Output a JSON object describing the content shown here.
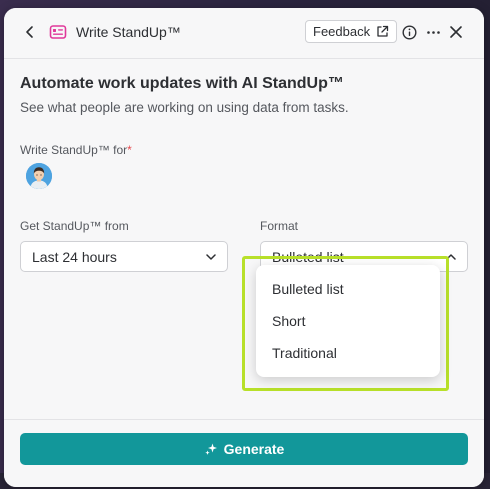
{
  "header": {
    "title": "Write StandUp™",
    "feedback_label": "Feedback",
    "icons": [
      "back-icon",
      "standup-app-icon",
      "external-link-icon",
      "info-icon",
      "more-icon",
      "close-icon"
    ]
  },
  "main": {
    "heading": "Automate work updates with AI StandUp™",
    "subheading": "See what people are working on using data from tasks.",
    "write_for_label": "Write StandUp™ for",
    "required_marker": "*",
    "period_label": "Get StandUp™ from",
    "period_value": "Last 24 hours",
    "format_label": "Format",
    "format_value": "Bulleted list",
    "format_options": [
      "Bulleted list",
      "Short",
      "Traditional"
    ]
  },
  "footer": {
    "generate_label": "Generate"
  },
  "colors": {
    "accent": "#12979a",
    "highlight": "#b8e02a",
    "required": "#e5484d",
    "app_icon": "#e0389a"
  }
}
